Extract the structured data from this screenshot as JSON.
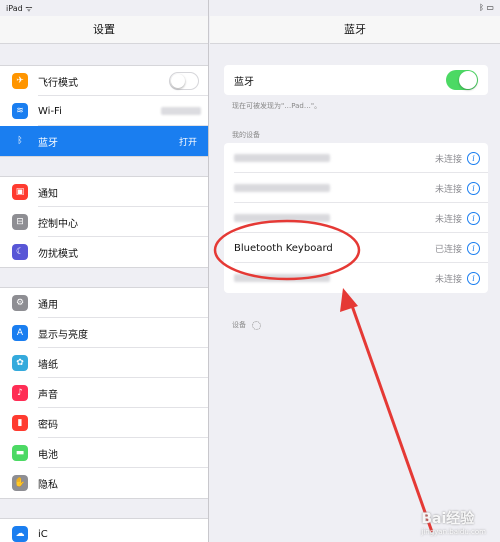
{
  "left": {
    "title": "设置",
    "groups": [
      [
        {
          "label": "飞行模式",
          "icon": "airplane-icon",
          "color": "#ff9500",
          "glyph": "✈"
        },
        {
          "label": "Wi-Fi",
          "icon": "wifi-icon",
          "color": "#1a7ef0",
          "glyph": "≋"
        },
        {
          "label": "蓝牙",
          "icon": "bluetooth-icon",
          "color": "#1a7ef0",
          "glyph": "ᛒ",
          "value": "打开",
          "selected": true
        }
      ],
      [
        {
          "label": "通知",
          "icon": "notifications-icon",
          "color": "#ff3b30",
          "glyph": "▣"
        },
        {
          "label": "控制中心",
          "icon": "control-center-icon",
          "color": "#8e8e93",
          "glyph": "⊟"
        },
        {
          "label": "勿扰模式",
          "icon": "moon-icon",
          "color": "#5856d6",
          "glyph": "☾"
        }
      ],
      [
        {
          "label": "通用",
          "icon": "gear-icon",
          "color": "#8e8e93",
          "glyph": "⚙"
        },
        {
          "label": "显示与亮度",
          "icon": "display-icon",
          "color": "#1a7ef0",
          "glyph": "A"
        },
        {
          "label": "墙纸",
          "icon": "wallpaper-icon",
          "color": "#34aadc",
          "glyph": "✿"
        },
        {
          "label": "声音",
          "icon": "sound-icon",
          "color": "#ff2d55",
          "glyph": "♪"
        },
        {
          "label": "密码",
          "icon": "lock-icon",
          "color": "#ff3b30",
          "glyph": "▮"
        },
        {
          "label": "电池",
          "icon": "battery-icon",
          "color": "#4cd964",
          "glyph": "▬"
        },
        {
          "label": "隐私",
          "icon": "privacy-hand-icon",
          "color": "#8e8e93",
          "glyph": "✋"
        }
      ]
    ],
    "bottom_label": "iC"
  },
  "right": {
    "title": "蓝牙",
    "bluetooth_label": "蓝牙",
    "discoverable_note": "现在可被发现为\"…Pad…\"。",
    "my_devices_header": "我的设备",
    "devices": [
      {
        "name": "",
        "status": "未连接"
      },
      {
        "name": "",
        "status": "未连接"
      },
      {
        "name": "",
        "status": "未连接"
      },
      {
        "name": "Bluetooth Keyboard",
        "status": "已连接"
      },
      {
        "name": "",
        "status": "未连接"
      }
    ],
    "devices_header": "设备"
  },
  "watermark": {
    "brand": "Bai经验",
    "url": "jingyan.baidu.com"
  },
  "colors": {
    "accent": "#1a7ef0",
    "toggle_on": "#4cd964",
    "annotation": "#e53935"
  }
}
